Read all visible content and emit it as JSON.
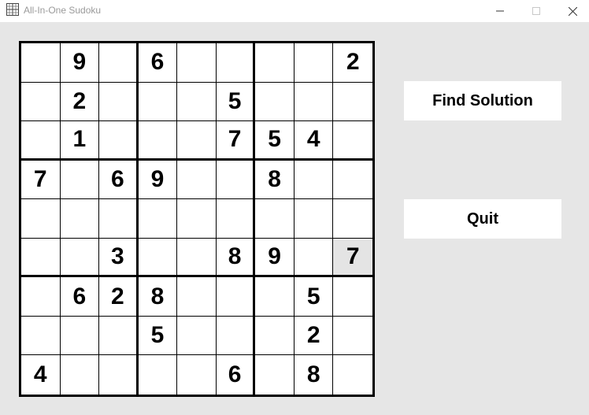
{
  "window": {
    "title": "All-In-One Sudoku",
    "icon": "sudoku-grid-icon",
    "controls": [
      "minimize-icon",
      "maximize-icon",
      "close-icon"
    ]
  },
  "board": {
    "rows": [
      [
        "",
        "9",
        "",
        "6",
        "",
        "",
        "",
        "",
        "2"
      ],
      [
        "",
        "2",
        "",
        "",
        "",
        "5",
        "",
        "",
        ""
      ],
      [
        "",
        "1",
        "",
        "",
        "",
        "7",
        "5",
        "4",
        ""
      ],
      [
        "7",
        "",
        "6",
        "9",
        "",
        "",
        "8",
        "",
        ""
      ],
      [
        "",
        "",
        "",
        "",
        "",
        "",
        "",
        "",
        ""
      ],
      [
        "",
        "",
        "3",
        "",
        "",
        "8",
        "9",
        "",
        "7"
      ],
      [
        "",
        "6",
        "2",
        "8",
        "",
        "",
        "",
        "5",
        ""
      ],
      [
        "",
        "",
        "",
        "5",
        "",
        "",
        "",
        "2",
        ""
      ],
      [
        "4",
        "",
        "",
        "",
        "",
        "6",
        "",
        "8",
        ""
      ]
    ],
    "selected_cell": {
      "row": 5,
      "col": 8
    },
    "selected_color": "#e4e4e4"
  },
  "buttons": {
    "find_solution": "Find Solution",
    "quit": "Quit"
  }
}
